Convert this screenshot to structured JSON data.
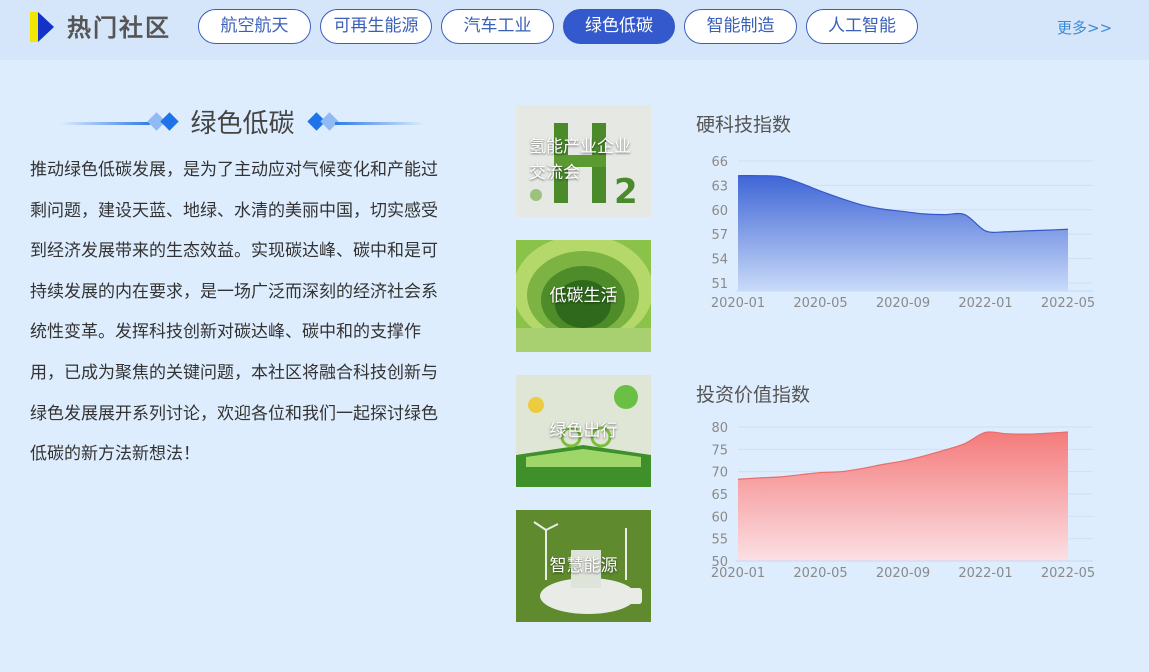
{
  "header": {
    "title": "热门社区",
    "tabs": [
      {
        "label": "航空航天",
        "active": false
      },
      {
        "label": "可再生能源",
        "active": false
      },
      {
        "label": "汽车工业",
        "active": false
      },
      {
        "label": "绿色低碳",
        "active": true
      },
      {
        "label": "智能制造",
        "active": false
      },
      {
        "label": "人工智能",
        "active": false
      }
    ],
    "more": "更多>>"
  },
  "intro": {
    "title": "绿色低碳",
    "body": "推动绿色低碳发展，是为了主动应对气候变化和产能过剩问题，建设天蓝、地绿、水清的美丽中国，切实感受到经济发展带来的生态效益。实现碳达峰、碳中和是可持续发展的内在要求，是一场广泛而深刻的经济社会系统性变革。发挥科技创新对碳达峰、碳中和的支撑作用，已成为聚焦的关键问题，本社区将融合科技创新与绿色发展展开系列讨论，欢迎各位和我们一起探讨绿色低碳的新方法新想法！"
  },
  "thumbnails": [
    {
      "label": "氢能产业企业交流会",
      "icon": "hydrogen-h2-moss-image"
    },
    {
      "label": "低碳生活",
      "icon": "paper-cut-green-city-image"
    },
    {
      "label": "绿色出行",
      "icon": "cyclist-on-book-image"
    },
    {
      "label": "智慧能源",
      "icon": "wind-turbine-bulb-image"
    }
  ],
  "colors": {
    "accent": "#3359cc",
    "chart1_fill_top": "#3f66d6",
    "chart1_fill_bottom": "#c9daf8",
    "chart2_fill_top": "#f47b7b",
    "chart2_fill_bottom": "#fbe0e4"
  },
  "chart_data": [
    {
      "type": "area",
      "title": "硬科技指数",
      "x_ticks": [
        "2020-01",
        "2020-05",
        "2020-09",
        "2022-01",
        "2022-05"
      ],
      "x": [
        "2020-01",
        "2020-02",
        "2020-03",
        "2020-04",
        "2020-05",
        "2020-06",
        "2020-07",
        "2020-08",
        "2020-09",
        "2020-10",
        "2020-11",
        "2020-12",
        "2022-01",
        "2022-02",
        "2022-03",
        "2022-04",
        "2022-05"
      ],
      "values": [
        64.2,
        64.2,
        64.1,
        63.3,
        62.3,
        61.4,
        60.6,
        60.1,
        59.8,
        59.5,
        59.4,
        59.4,
        57.4,
        57.3,
        57.4,
        57.5,
        57.6
      ],
      "y_ticks": [
        51,
        54,
        57,
        60,
        63,
        66
      ],
      "ylim": [
        50,
        66.5
      ]
    },
    {
      "type": "area",
      "title": "投资价值指数",
      "x_ticks": [
        "2020-01",
        "2020-05",
        "2020-09",
        "2022-01",
        "2022-05"
      ],
      "x": [
        "2020-01",
        "2020-02",
        "2020-03",
        "2020-04",
        "2020-05",
        "2020-06",
        "2020-07",
        "2020-08",
        "2020-09",
        "2020-10",
        "2020-11",
        "2020-12",
        "2022-01",
        "2022-02",
        "2022-03",
        "2022-04",
        "2022-05"
      ],
      "values": [
        68.3,
        68.6,
        68.8,
        69.3,
        69.8,
        70.0,
        70.7,
        71.6,
        72.4,
        73.5,
        74.8,
        76.3,
        78.8,
        78.5,
        78.4,
        78.6,
        78.9
      ],
      "y_ticks": [
        50,
        55,
        60,
        65,
        70,
        75,
        80
      ],
      "ylim": [
        50,
        80
      ]
    }
  ]
}
